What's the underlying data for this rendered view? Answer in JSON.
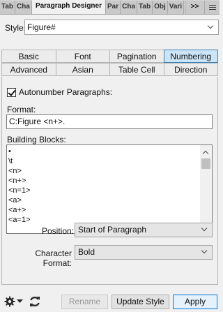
{
  "panel_tabs": [
    {
      "label": "Tab",
      "active": false
    },
    {
      "label": "Cha",
      "active": false
    },
    {
      "label": "Paragraph Designer",
      "active": true
    },
    {
      "label": "Par",
      "active": false
    },
    {
      "label": "Cha",
      "active": false
    },
    {
      "label": "Tab",
      "active": false
    },
    {
      "label": "Obj",
      "active": false
    },
    {
      "label": "Vari",
      "active": false
    }
  ],
  "overflow_label": ">>",
  "style": {
    "label": "Style:",
    "value": "Figure#"
  },
  "section_tabs_row1": [
    "Basic",
    "Font",
    "Pagination",
    "Numbering"
  ],
  "section_tabs_row2": [
    "Advanced",
    "Asian",
    "Table Cell",
    "Direction"
  ],
  "active_section": "Numbering",
  "autonumber": {
    "label": "Autonumber Paragraphs:",
    "checked": true
  },
  "format": {
    "label": "Format:",
    "value": "C:Figure <n+>."
  },
  "building_blocks": {
    "label": "Building Blocks:",
    "items": [
      "•",
      "\\t",
      "<n>",
      "<n+>",
      "<n=1>",
      "<a>",
      "<a+>",
      "<a=1>"
    ]
  },
  "position": {
    "label": "Position:",
    "value": "Start of Paragraph"
  },
  "char_format": {
    "label": "Character Format:",
    "value": "Bold"
  },
  "buttons": {
    "rename": "Rename",
    "update_style": "Update Style",
    "apply": "Apply"
  },
  "colors": {
    "accent": "#3c7fb1",
    "active_tab_bg": "#cce4f7",
    "apply_border": "#0078d7"
  },
  "icons": {
    "gear": "gear-icon",
    "refresh": "refresh-icon",
    "menu": "hamburger-menu-icon"
  }
}
